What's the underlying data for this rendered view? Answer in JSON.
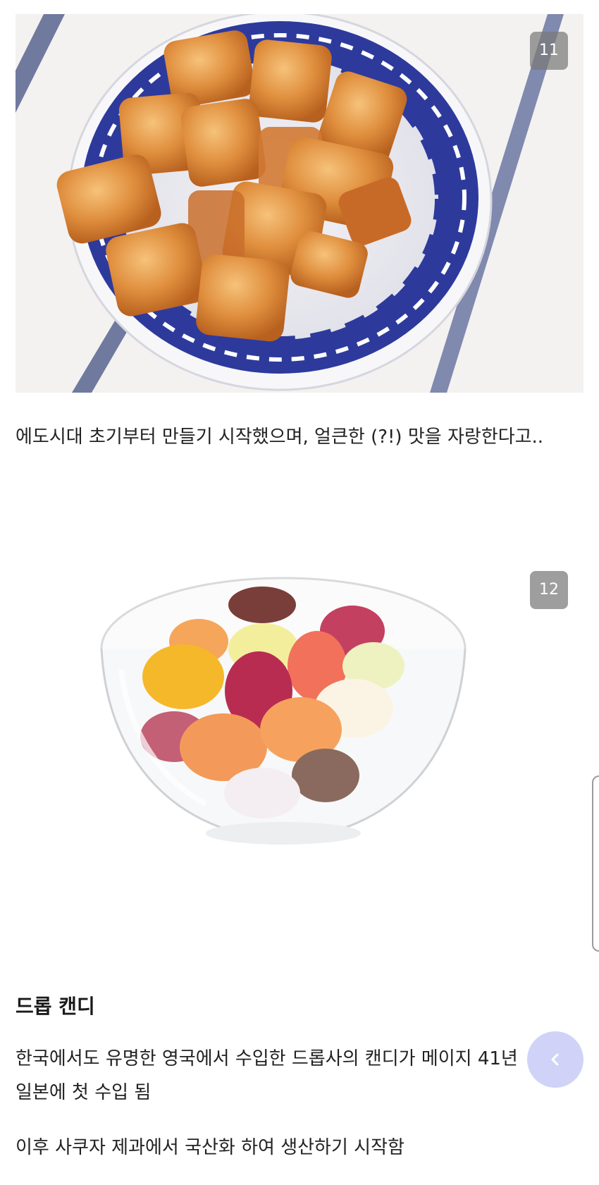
{
  "figures": [
    {
      "counter": "11",
      "subject": "amber hard candies in a blue-patterned bowl"
    },
    {
      "counter": "12",
      "subject": "assorted colorful drop candies in a glass bowl"
    }
  ],
  "paragraphs": {
    "p1": "에도시대 초기부터 만들기 시작했으며, 얼큰한 (?!) 맛을 자랑한다고..",
    "p2": "한국에서도 유명한 영국에서 수입한 드롭사의 캔디가 메이지 41년 일본에 첫 수입 됨",
    "p3": "이후 사쿠자 제과에서 국산화 하여 생산하기 시작함"
  },
  "section_heading": "드롭 캔디",
  "controls": {
    "fab_icon": "chevron-left-icon",
    "scroll_handle": "scroll-handle"
  },
  "colors": {
    "text": "#222222",
    "counter_bg": "#787878",
    "bowl_blue": "#2d3a9c",
    "candy_amber": "#d9843a",
    "fab": "#aab0f0"
  }
}
